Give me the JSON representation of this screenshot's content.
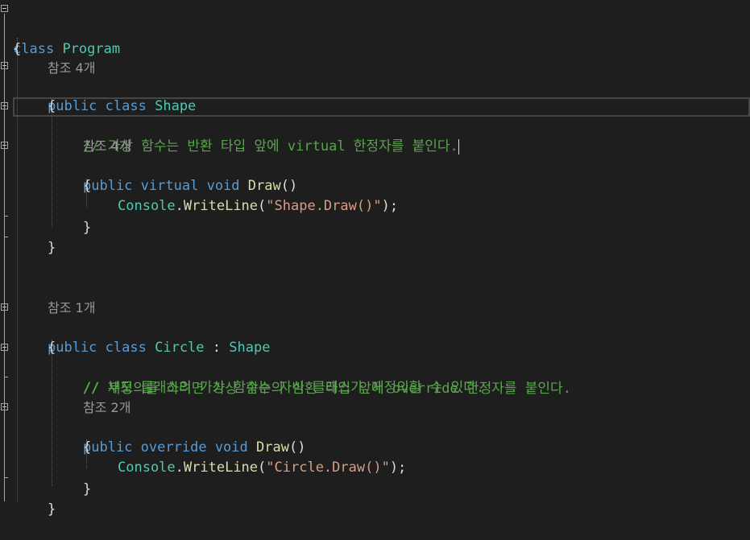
{
  "code": {
    "class_kw": "class",
    "program_name": "Program",
    "open_brace": "{",
    "close_brace": "}",
    "references_shape": "참조 4개",
    "public_kw": "public",
    "shape_name": "Shape",
    "comment_1": "// 가상 함수는 반환 타입 앞에 virtual 한정자를 붙인다.",
    "references_shape_draw": "참조 4개",
    "virtual_kw": "virtual",
    "void_kw": "void",
    "draw_method": "Draw",
    "parens": "()",
    "console_type": "Console",
    "writeline_method": "WriteLine",
    "shape_draw_string": "\"Shape.Draw()\"",
    "references_circle": "참조 1개",
    "circle_name": "Circle",
    "colon": ":",
    "comment_2": "// 부모 클래스의 가상 함수는 자식 클래스가 재정의할 수 있다.",
    "comment_3": "// 재정의를 하려면 가상 함수의 반환 타입 앞에 override 한정자를 붙인다.",
    "references_circle_draw": "참조 2개",
    "override_kw": "override",
    "circle_draw_string": "\"Circle.Draw()\"",
    "dot": ".",
    "call_open": "(",
    "call_close": ");"
  },
  "colors": {
    "background": "#1e1e1e",
    "keyword": "#569cd6",
    "type": "#4ec9b0",
    "method": "#dcdcaa",
    "string": "#d69d85",
    "comment": "#57a64a",
    "reference_lens": "#999999"
  }
}
